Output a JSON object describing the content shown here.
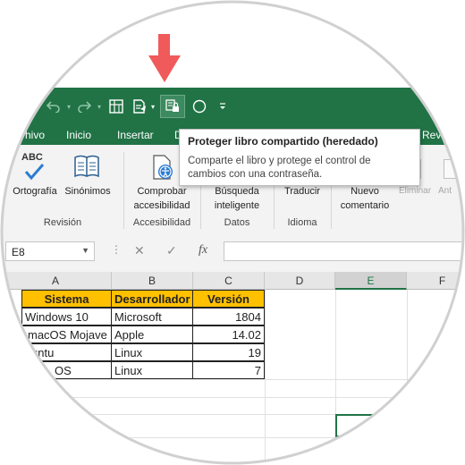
{
  "accent_color": "#217346",
  "header_fill_color": "#ffc000",
  "arrow_color": "#f05a5a",
  "quick_access": {
    "icons": [
      "undo-icon",
      "redo-icon",
      "workbook-icon",
      "form-icon",
      "dropdown-icon",
      "protect-shared-workbook-icon",
      "circle-icon",
      "customize-icon"
    ]
  },
  "tabs": {
    "archivo": "hivo",
    "inicio": "Inicio",
    "insertar": "Insertar",
    "partial": "D",
    "revisar": "Rev"
  },
  "ribbon": {
    "ortografia": "Ortografía",
    "abc": "ABC",
    "sinonimos": "Sinónimos",
    "revision_group": "Revisión",
    "comprobar_1": "Comprobar",
    "comprobar_2": "accesibilidad",
    "accesibilidad_group": "Accesibilidad",
    "busqueda_1": "Búsqueda",
    "busqueda_2": "inteligente",
    "datos_group": "Datos",
    "traducir": "Traducir",
    "idioma_group": "Idioma",
    "nuevo_1": "Nuevo",
    "nuevo_2": "comentario",
    "eliminar": "Eliminar",
    "anterior": "Ant"
  },
  "tooltip": {
    "title": "Proteger libro compartido (heredado)",
    "description": "Comparte el libro y protege el control de cambios con una contraseña."
  },
  "formula_bar": {
    "name_box": "E8",
    "cancel": "✕",
    "confirm": "✓",
    "fx": "fx"
  },
  "columns": [
    "A",
    "B",
    "C",
    "D",
    "E",
    "F"
  ],
  "table": {
    "headers": [
      "Sistema",
      "Desarrollador",
      "Versión"
    ],
    "rows": [
      [
        "Windows 10",
        "Microsoft",
        "1804"
      ],
      [
        "macOS Mojave",
        "Apple",
        "14.02"
      ],
      [
        "untu",
        "Linux",
        "19"
      ],
      [
        "OS",
        "Linux",
        "7"
      ]
    ]
  }
}
